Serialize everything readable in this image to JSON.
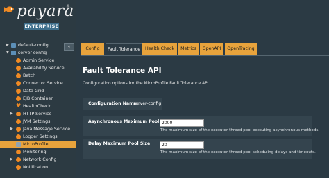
{
  "brand": {
    "logo": "payara",
    "reg": "®",
    "edition": "ENTERPRISE"
  },
  "collapse_label": "«",
  "sidebar": {
    "items": [
      {
        "label": "default-config",
        "level": 0,
        "arrow": "▶",
        "icon": "blue"
      },
      {
        "label": "server-config",
        "level": 0,
        "arrow": "▼",
        "icon": "blue"
      },
      {
        "label": "Admin Service",
        "level": 1,
        "arrow": "",
        "icon": "orange"
      },
      {
        "label": "Availability Service",
        "level": 1,
        "arrow": "",
        "icon": "orange"
      },
      {
        "label": "Batch",
        "level": 1,
        "arrow": "",
        "icon": "orange"
      },
      {
        "label": "Connector Service",
        "level": 1,
        "arrow": "",
        "icon": "orange"
      },
      {
        "label": "Data Grid",
        "level": 1,
        "arrow": "",
        "icon": "orange"
      },
      {
        "label": "EJB Container",
        "level": 1,
        "arrow": "",
        "icon": "orange"
      },
      {
        "label": "HealthCheck",
        "level": 1,
        "arrow": "",
        "icon": "heart"
      },
      {
        "label": "HTTP Service",
        "level": 1,
        "arrow": "▶",
        "icon": "orange"
      },
      {
        "label": "JVM Settings",
        "level": 1,
        "arrow": "",
        "icon": "orange"
      },
      {
        "label": "Java Message Service",
        "level": 1,
        "arrow": "▶",
        "icon": "orange"
      },
      {
        "label": "Logger Settings",
        "level": 1,
        "arrow": "",
        "icon": "orange"
      },
      {
        "label": "MicroProfile",
        "level": 1,
        "arrow": "",
        "icon": "grey",
        "selected": true
      },
      {
        "label": "Monitoring",
        "level": 1,
        "arrow": "",
        "icon": "orange"
      },
      {
        "label": "Network Config",
        "level": 1,
        "arrow": "▶",
        "icon": "orange"
      },
      {
        "label": "Notification",
        "level": 1,
        "arrow": "",
        "icon": "orange"
      }
    ]
  },
  "tabs": [
    {
      "label": "Config",
      "active": false
    },
    {
      "label": "Fault Tolerance",
      "active": true
    },
    {
      "label": "Health Check",
      "active": false
    },
    {
      "label": "Metrics",
      "active": false
    },
    {
      "label": "OpenAPI",
      "active": false
    },
    {
      "label": "OpenTracing",
      "active": false
    }
  ],
  "main": {
    "title": "Fault Tolerance API",
    "description": "Configuration options for the MicroProfile Fault Tolerance API.",
    "config_name_label": "Configuration Name:",
    "config_name_value": "server-config",
    "properties": [
      {
        "label": "Asynchronous Maximum Pool Size",
        "value": "2000",
        "help": "The maximum size of the executor thread pool executing asynchronous methods."
      },
      {
        "label": "Delay Maximum Pool Size",
        "value": "20",
        "help": "The maximum size of the executor thread pool scheduling delays and timeouts."
      }
    ]
  },
  "colors": {
    "accent": "#e8a33c",
    "background": "#2b3a44",
    "panel": "#34444e",
    "brand_orange": "#f08a24"
  }
}
